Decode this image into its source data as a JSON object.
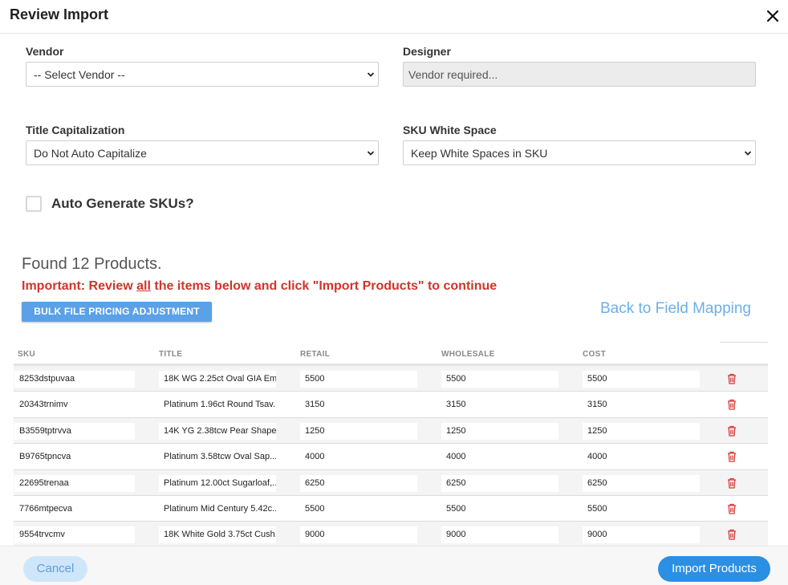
{
  "dialog": {
    "title": "Review Import"
  },
  "form": {
    "vendor": {
      "label": "Vendor",
      "value": "-- Select Vendor --"
    },
    "designer": {
      "label": "Designer",
      "value": "Vendor required..."
    },
    "title_capitalization": {
      "label": "Title Capitalization",
      "value": "Do Not Auto Capitalize"
    },
    "sku_white_space": {
      "label": "SKU White Space",
      "value": "Keep White Spaces in SKU"
    },
    "auto_generate": {
      "label": "Auto Generate SKUs?",
      "checked": false
    }
  },
  "summary": {
    "found_text": "Found 12 Products.",
    "important_prefix": "Important: Review ",
    "important_emph": "all",
    "important_suffix": " the items below and click \"Import Products\" to continue"
  },
  "actions": {
    "bulk_label": "BULK FILE PRICING ADJUSTMENT",
    "back_label": "Back to Field Mapping"
  },
  "table": {
    "columns": [
      "SKU",
      "TITLE",
      "RETAIL",
      "WHOLESALE",
      "COST"
    ],
    "rows": [
      {
        "sku": "8253dstpuvaa",
        "title": "18K WG 2.25ct Oval GIA Em...",
        "retail": "5500",
        "wholesale": "5500",
        "cost": "5500"
      },
      {
        "sku": "20343trnimv",
        "title": "Platinum 1.96ct Round Tsav...",
        "retail": "3150",
        "wholesale": "3150",
        "cost": "3150"
      },
      {
        "sku": "B3559tptrvva",
        "title": "14K YG 2.38tcw Pear Shape...",
        "retail": "1250",
        "wholesale": "1250",
        "cost": "1250"
      },
      {
        "sku": "B9765tpncva",
        "title": "Platinum 3.58tcw Oval Sap...",
        "retail": "4000",
        "wholesale": "4000",
        "cost": "4000"
      },
      {
        "sku": "22695trenaa",
        "title": "Platinum 12.00ct Sugarloaf,...",
        "retail": "6250",
        "wholesale": "6250",
        "cost": "6250"
      },
      {
        "sku": "7766mtpecva",
        "title": "Platinum Mid Century 5.42c...",
        "retail": "5500",
        "wholesale": "5500",
        "cost": "5500"
      },
      {
        "sku": "9554trvcmv",
        "title": "18K White Gold 3.75ct Cush...",
        "retail": "9000",
        "wholesale": "9000",
        "cost": "9000"
      }
    ]
  },
  "footer": {
    "cancel_label": "Cancel",
    "import_label": "Import Products"
  },
  "colors": {
    "accent": "#2b8fe3",
    "link": "#6bb0e8",
    "danger": "#d0342c",
    "bulk_button": "#5aa1e8",
    "cancel_bg": "#cfe6fa"
  },
  "icons": {
    "close": "close-icon",
    "select": "chevron-down-icon",
    "delete": "trash-icon"
  }
}
